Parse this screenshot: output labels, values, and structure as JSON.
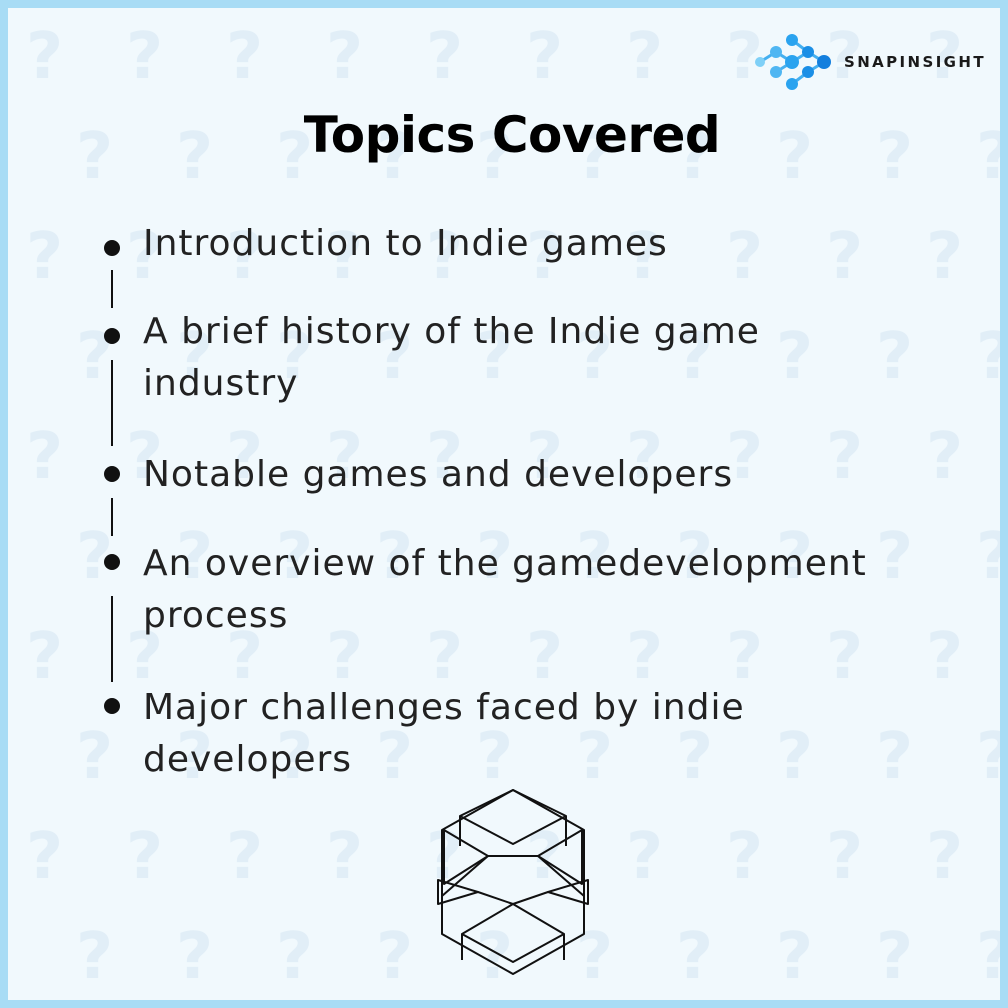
{
  "brand": {
    "name": "SNAPINSIGHT",
    "icon": "molecule-dots-icon",
    "accent": "#2aa3ef"
  },
  "title": "Topics Covered",
  "topics": [
    {
      "line1": "Introduction to Indie games",
      "line2": ""
    },
    {
      "line1": "A brief history of the Indie game",
      "line2": "industry"
    },
    {
      "line1": "Notable games and developers",
      "line2": ""
    },
    {
      "line1": "An overview of the gamedevelopment",
      "line2": "process"
    },
    {
      "line1": "Major challenges faced by indie",
      "line2": "developers"
    }
  ],
  "decor": {
    "background_pattern": "question-mark-icon",
    "bottom_emblem": "geometric-hexagon-icon"
  },
  "colors": {
    "border": "#a8dcf5",
    "background": "#f1f9fd",
    "text": "#222222"
  }
}
